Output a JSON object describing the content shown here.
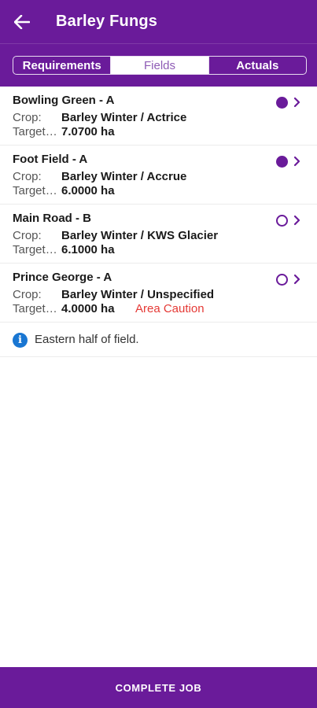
{
  "header": {
    "title": "Barley Fungs",
    "back_icon": "arrow-left-icon"
  },
  "tabs": [
    {
      "label": "Requirements",
      "active": false
    },
    {
      "label": "Fields",
      "active": true
    },
    {
      "label": "Actuals",
      "active": false
    }
  ],
  "fields": [
    {
      "name": "Bowling Green - A",
      "crop_label": "Crop:",
      "crop_value": "Barley Winter / Actrice",
      "target_label": "Target…",
      "target_value": "7.0700 ha",
      "caution": "",
      "status": "complete"
    },
    {
      "name": "Foot Field - A",
      "crop_label": "Crop:",
      "crop_value": "Barley Winter / Accrue",
      "target_label": "Target…",
      "target_value": "6.0000 ha",
      "caution": "",
      "status": "complete"
    },
    {
      "name": "Main Road - B",
      "crop_label": "Crop:",
      "crop_value": "Barley Winter / KWS Glacier",
      "target_label": "Target…",
      "target_value": "6.1000 ha",
      "caution": "",
      "status": "pending"
    },
    {
      "name": "Prince George - A",
      "crop_label": "Crop:",
      "crop_value": "Barley Winter / Unspecified",
      "target_label": "Target…",
      "target_value": "4.0000 ha",
      "caution": "Area Caution",
      "status": "pending"
    }
  ],
  "note": {
    "icon": "info-icon",
    "icon_glyph": "i",
    "text": "Eastern half of field."
  },
  "footer": {
    "button_label": "COMPLETE JOB"
  },
  "colors": {
    "brand": "#6a1b9a",
    "caution": "#e53935",
    "info": "#1976d2"
  }
}
